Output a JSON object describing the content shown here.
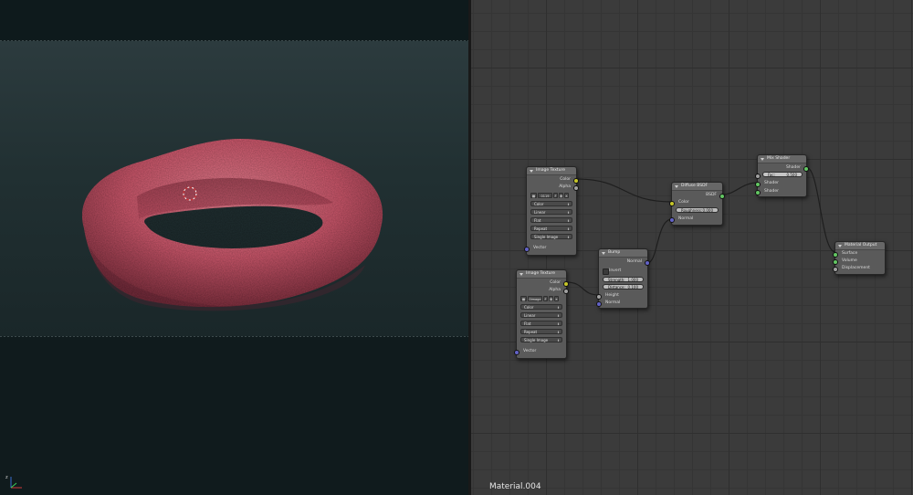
{
  "viewport": {
    "object": "torus-mesh",
    "object_color": "#c9566a",
    "cursor": "3d-cursor-icon",
    "axis": "axis-gizmo-icon"
  },
  "node_editor": {
    "material_name": "Material.004",
    "nodes": {
      "image_texture_1": {
        "title": "Image Texture",
        "outputs": [
          "Color",
          "Alpha"
        ],
        "image_name": "0119",
        "image_users": "F",
        "color_mode": "Color",
        "interpolation": "Linear",
        "projection": "Flat",
        "extension": "Repeat",
        "source": "Single Image",
        "input": "Vector"
      },
      "image_texture_2": {
        "title": "Image Texture",
        "outputs": [
          "Color",
          "Alpha"
        ],
        "image_name": "0image",
        "image_users": "F",
        "color_mode": "Color",
        "interpolation": "Linear",
        "projection": "Flat",
        "extension": "Repeat",
        "source": "Single Image",
        "input": "Vector"
      },
      "diffuse_bsdf": {
        "title": "Diffuse BSDF",
        "output": "BSDF",
        "input_color": "Color",
        "roughness_label": "Roughness:",
        "roughness_value": "0.000",
        "input_normal": "Normal"
      },
      "bump": {
        "title": "Bump",
        "output": "Normal",
        "invert_label": "Invert",
        "strength_label": "Strength:",
        "strength_value": "1.000",
        "distance_label": "Distance:",
        "distance_value": "0.100",
        "input_height": "Height",
        "input_normal": "Normal"
      },
      "mix_shader": {
        "title": "Mix Shader",
        "output": "Shader",
        "fac_label": "Fac:",
        "fac_value": "0.500",
        "input_shader_1": "Shader",
        "input_shader_2": "Shader"
      },
      "material_output": {
        "title": "Material Output",
        "input_surface": "Surface",
        "input_volume": "Volume",
        "input_displacement": "Displacement"
      }
    },
    "colors": {
      "grid_bg": "#3b3b3b",
      "node_body": "#5a5a5a",
      "socket_color": "#c7c729",
      "socket_value": "#a1a1a1",
      "socket_vector": "#6363c7",
      "socket_shader": "#63c763"
    }
  }
}
